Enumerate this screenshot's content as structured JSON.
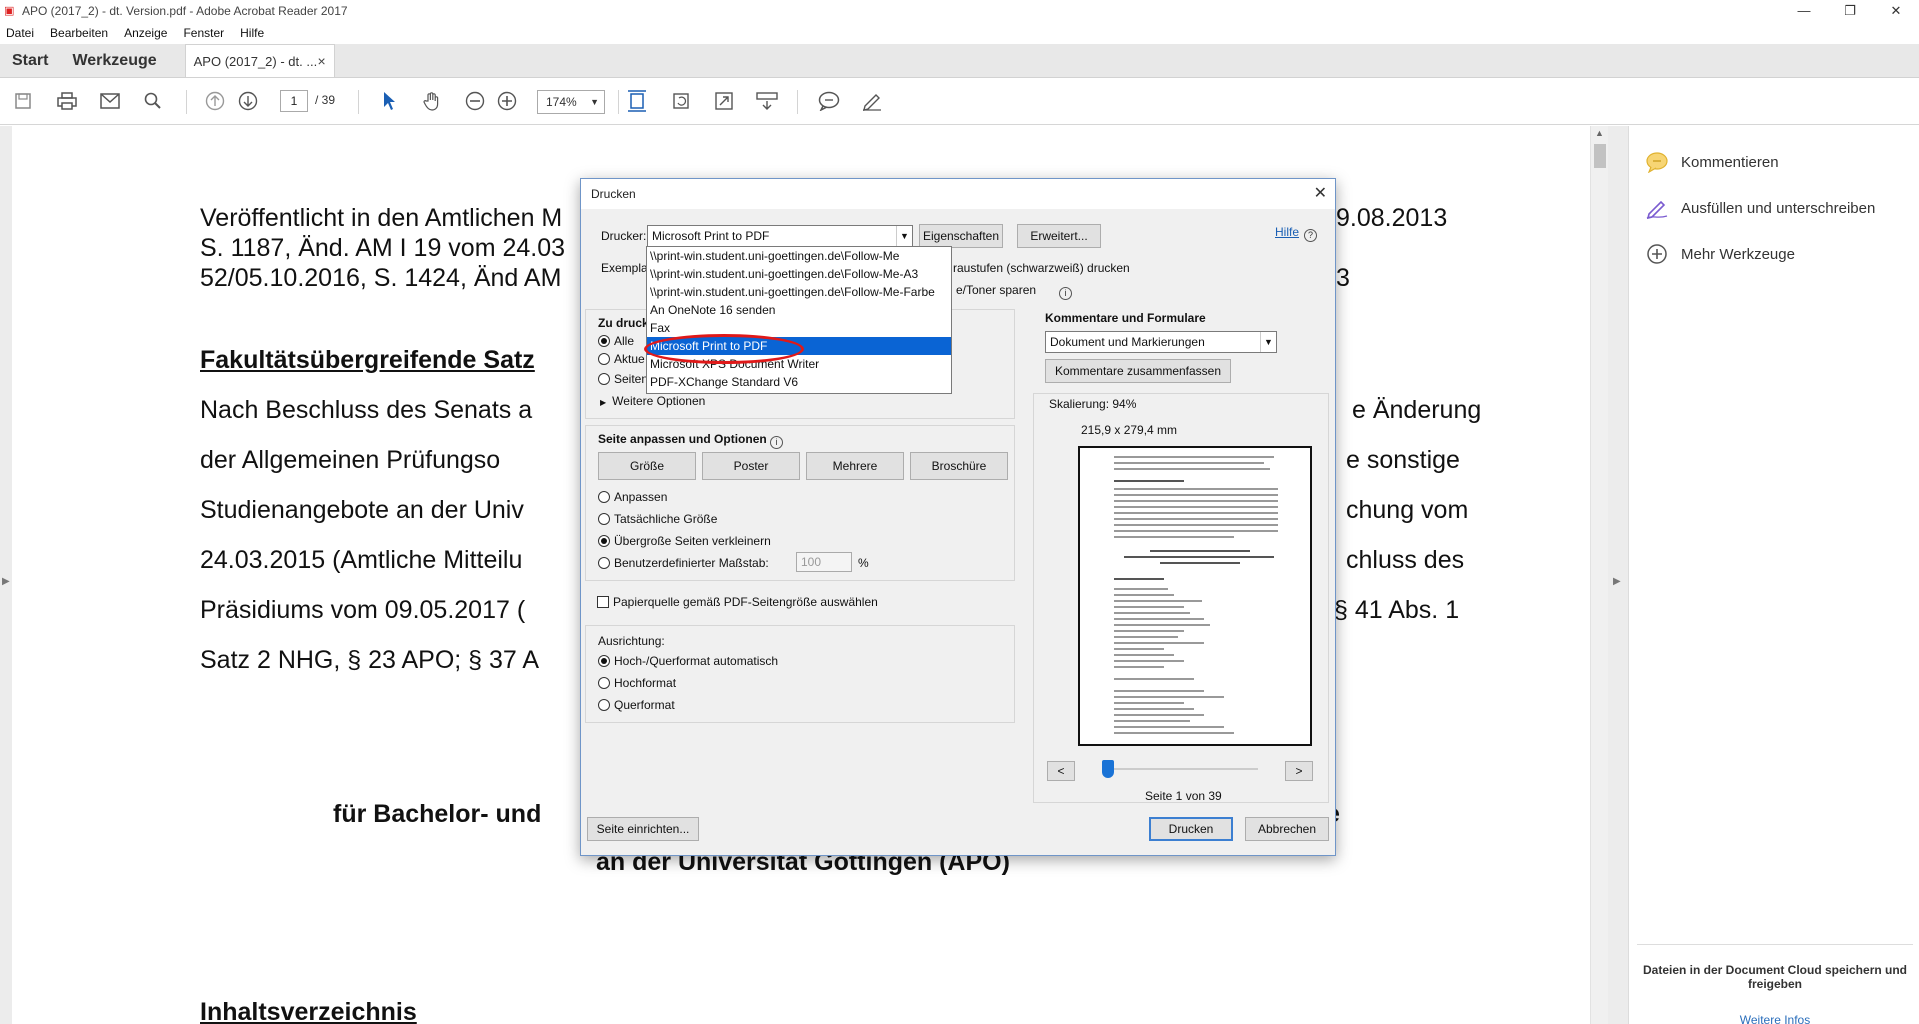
{
  "window": {
    "title": "APO (2017_2) - dt. Version.pdf - Adobe Acrobat Reader 2017",
    "controls": [
      "—",
      "❐",
      "✕"
    ]
  },
  "menu": [
    "Datei",
    "Bearbeiten",
    "Anzeige",
    "Fenster",
    "Hilfe"
  ],
  "tabs": {
    "start": "Start",
    "tools": "Werkzeuge",
    "doc": "APO (2017_2) - dt. ...",
    "close": "×"
  },
  "toolbar": {
    "page_current": "1",
    "page_total": "/ 39",
    "zoom": "174%"
  },
  "document": {
    "line1a": "Veröffentlicht in den Amtlichen M",
    "line1b": "9.08.2013",
    "line2": "S. 1187, Änd. AM I 19 vom 24.03",
    "line3a": "52/05.10.2016, S. 1424, Änd AM",
    "line3b": "3",
    "heading": "Fakultätsübergreifende Satz",
    "para": [
      {
        "l": "Nach Beschluss des Senats a",
        "r": "e Änderung"
      },
      {
        "l": "der Allgemeinen Prüfungso",
        "r": "e sonstige"
      },
      {
        "l": "Studienangebote an der Univ",
        "r": "chung vom"
      },
      {
        "l": "24.03.2015 (Amtliche Mitteilu",
        "r": "chluss des"
      },
      {
        "l": "Präsidiums vom 09.05.2017 (",
        "r": "§ 41 Abs. 1"
      },
      {
        "l": "Satz 2 NHG, § 23 APO; § 37 A",
        "r": ""
      }
    ],
    "title_line1a": "für Bachelor- und",
    "title_line1b": "e",
    "title_line2": "an der Universität Göttingen (APO)",
    "toc": "Inhaltsverzeichnis"
  },
  "right_panel": {
    "items": [
      {
        "label": "Kommentieren",
        "icon": "comment-icon"
      },
      {
        "label": "Ausfüllen und unterschreiben",
        "icon": "sign-icon"
      },
      {
        "label": "Mehr Werkzeuge",
        "icon": "plus-circle-icon"
      }
    ],
    "footer_text": "Dateien in der Document Cloud speichern und freigeben",
    "footer_link": "Weitere Infos"
  },
  "print_dialog": {
    "title": "Drucken",
    "printer_label": "Drucker:",
    "printer_value": "Microsoft Print to PDF",
    "properties_btn": "Eigenschaften",
    "advanced_btn": "Erweitert...",
    "help_link": "Hilfe",
    "copies_label": "Exemplar",
    "grayscale_label": "raustufen (schwarzweiß) drucken",
    "toner_label": "e/Toner sparen",
    "printer_options": [
      "\\\\print-win.student.uni-goettingen.de\\Follow-Me",
      "\\\\print-win.student.uni-goettingen.de\\Follow-Me-A3",
      "\\\\print-win.student.uni-goettingen.de\\Follow-Me-Farbe",
      "An OneNote 16 senden",
      "Fax",
      "Microsoft Print to PDF",
      "Microsoft XPS Document Writer",
      "PDF-XChange Standard V6"
    ],
    "selected_option": "Microsoft Print to PDF",
    "pages_group": {
      "title": "Zu druck",
      "all": "Alle",
      "current": "Aktue",
      "pages": "Seiten",
      "more_options": "Weitere Optionen"
    },
    "sizing_group": {
      "title": "Seite anpassen und Optionen",
      "buttons": [
        "Größe",
        "Poster",
        "Mehrere",
        "Broschüre"
      ],
      "fit": "Anpassen",
      "actual": "Tatsächliche Größe",
      "shrink": "Übergroße Seiten verkleinern",
      "custom": "Benutzerdefinierter Maßstab:",
      "custom_value": "100",
      "custom_unit": "%",
      "paper_source": "Papierquelle gemäß PDF-Seitengröße auswählen"
    },
    "orientation_group": {
      "title": "Ausrichtung:",
      "auto": "Hoch-/Querformat automatisch",
      "portrait": "Hochformat",
      "landscape": "Querformat"
    },
    "comments_group": {
      "title": "Kommentare und Formulare",
      "value": "Dokument und Markierungen",
      "summarize_btn": "Kommentare zusammenfassen"
    },
    "preview": {
      "scaling": "Skalierung: 94%",
      "paper_size": "215,9 x 279,4 mm",
      "prev": "<",
      "next": ">",
      "page_indicator": "Seite 1 von 39"
    },
    "page_setup_btn": "Seite einrichten...",
    "print_btn": "Drucken",
    "cancel_btn": "Abbrechen"
  }
}
